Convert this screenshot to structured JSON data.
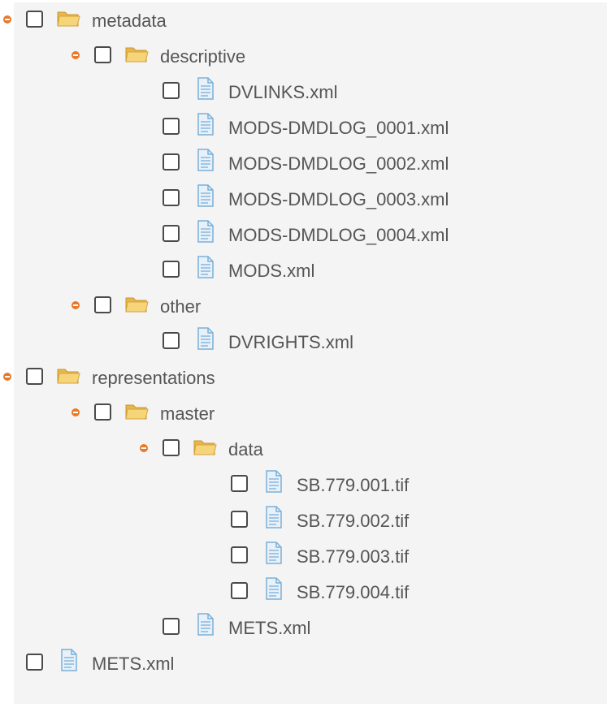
{
  "tree": {
    "nodes": [
      {
        "label": "metadata",
        "type": "folder",
        "level": 0,
        "expanded": true
      },
      {
        "label": "descriptive",
        "type": "folder",
        "level": 1,
        "expanded": true
      },
      {
        "label": "DVLINKS.xml",
        "type": "file",
        "level": 2
      },
      {
        "label": "MODS-DMDLOG_0001.xml",
        "type": "file",
        "level": 2
      },
      {
        "label": "MODS-DMDLOG_0002.xml",
        "type": "file",
        "level": 2
      },
      {
        "label": "MODS-DMDLOG_0003.xml",
        "type": "file",
        "level": 2
      },
      {
        "label": "MODS-DMDLOG_0004.xml",
        "type": "file",
        "level": 2
      },
      {
        "label": "MODS.xml",
        "type": "file",
        "level": 2
      },
      {
        "label": "other",
        "type": "folder",
        "level": 1,
        "expanded": true
      },
      {
        "label": "DVRIGHTS.xml",
        "type": "file",
        "level": 2
      },
      {
        "label": "representations",
        "type": "folder",
        "level": 0,
        "expanded": true
      },
      {
        "label": "master",
        "type": "folder",
        "level": 1,
        "expanded": true
      },
      {
        "label": "data",
        "type": "folder",
        "level": 2,
        "expanded": true
      },
      {
        "label": "SB.779.001.tif",
        "type": "file",
        "level": 3
      },
      {
        "label": "SB.779.002.tif",
        "type": "file",
        "level": 3
      },
      {
        "label": "SB.779.003.tif",
        "type": "file",
        "level": 3
      },
      {
        "label": "SB.779.004.tif",
        "type": "file",
        "level": 3
      },
      {
        "label": "METS.xml",
        "type": "file",
        "level": 2
      },
      {
        "label": "METS.xml",
        "type": "file",
        "level": 0
      }
    ]
  },
  "colors": {
    "toggle": "#e8792a",
    "folder": "#f2c75c",
    "file": "#7ab0d8",
    "text": "#555555",
    "background": "#f4f4f4"
  },
  "icons": {
    "folder": "folder-open-icon",
    "file": "file-text-icon",
    "toggle": "collapse-toggle-icon"
  }
}
